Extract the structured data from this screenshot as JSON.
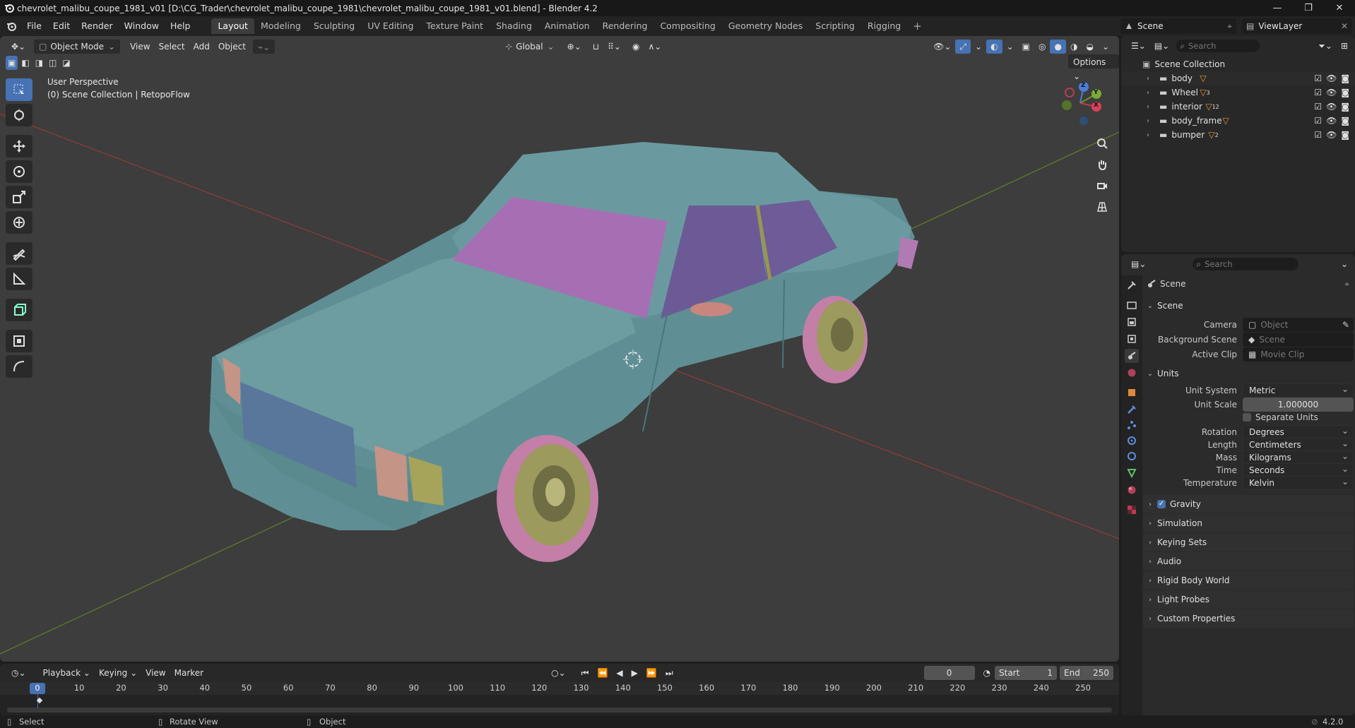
{
  "title_bar": {
    "title": "chevrolet_malibu_coupe_1981_v01 [D:\\CG_Trader\\chevrolet_malibu_coupe_1981\\chevrolet_malibu_coupe_1981_v01.blend] - Blender 4.2"
  },
  "menu": [
    "File",
    "Edit",
    "Render",
    "Window",
    "Help"
  ],
  "workspaces": [
    "Layout",
    "Modeling",
    "Sculpting",
    "UV Editing",
    "Texture Paint",
    "Shading",
    "Animation",
    "Rendering",
    "Compositing",
    "Geometry Nodes",
    "Scripting",
    "Rigging"
  ],
  "workspace_active": "Layout",
  "scene_selector": "Scene",
  "view_layer": "ViewLayer",
  "viewport": {
    "mode": "Object Mode",
    "menus": [
      "View",
      "Select",
      "Add",
      "Object"
    ],
    "transform_orientation": "Global",
    "options_label": "Options",
    "overlay_line1": "User Perspective",
    "overlay_line2": "(0) Scene Collection | RetopoFlow",
    "gizmo_axes": {
      "x": "X",
      "y": "Y",
      "z": "Z"
    }
  },
  "outliner": {
    "search_placeholder": "Search",
    "root": "Scene Collection",
    "items": [
      {
        "name": "body",
        "badge": ""
      },
      {
        "name": "Wheel",
        "badge": "3"
      },
      {
        "name": "interior",
        "badge": "12"
      },
      {
        "name": "body_frame",
        "badge": ""
      },
      {
        "name": "bumper",
        "badge": "2"
      }
    ]
  },
  "properties": {
    "search_placeholder": "Search",
    "context": "Scene",
    "scene_panel": "Scene",
    "camera_label": "Camera",
    "camera_placeholder": "Object",
    "bg_scene_label": "Background Scene",
    "bg_scene_placeholder": "Scene",
    "active_clip_label": "Active Clip",
    "active_clip_placeholder": "Movie Clip",
    "units_panel": "Units",
    "unit_system_label": "Unit System",
    "unit_system": "Metric",
    "unit_scale_label": "Unit Scale",
    "unit_scale": "1.000000",
    "separate_units": "Separate Units",
    "rotation_label": "Rotation",
    "rotation": "Degrees",
    "length_label": "Length",
    "length": "Centimeters",
    "mass_label": "Mass",
    "mass": "Kilograms",
    "time_label": "Time",
    "time": "Seconds",
    "temperature_label": "Temperature",
    "temperature": "Kelvin",
    "collapsed_panels": [
      "Gravity",
      "Simulation",
      "Keying Sets",
      "Audio",
      "Rigid Body World",
      "Light Probes",
      "Custom Properties"
    ]
  },
  "timeline": {
    "menus": [
      "Playback",
      "Keying",
      "View",
      "Marker"
    ],
    "current_frame": "0",
    "start_label": "Start",
    "start": "1",
    "end_label": "End",
    "end": "250",
    "ruler": [
      "0",
      "10",
      "20",
      "30",
      "40",
      "50",
      "60",
      "70",
      "80",
      "90",
      "100",
      "110",
      "120",
      "130",
      "140",
      "150",
      "160",
      "170",
      "180",
      "190",
      "200",
      "210",
      "220",
      "230",
      "240",
      "250"
    ]
  },
  "status": {
    "select": "Select",
    "rotate": "Rotate View",
    "object": "Object",
    "version": "4.2.0"
  },
  "colors": {
    "accent": "#4772b3",
    "car_body": "#5f8f94",
    "glass": "#9a6aa8",
    "tire": "#c37fa8",
    "rim": "#9c9a5c"
  }
}
